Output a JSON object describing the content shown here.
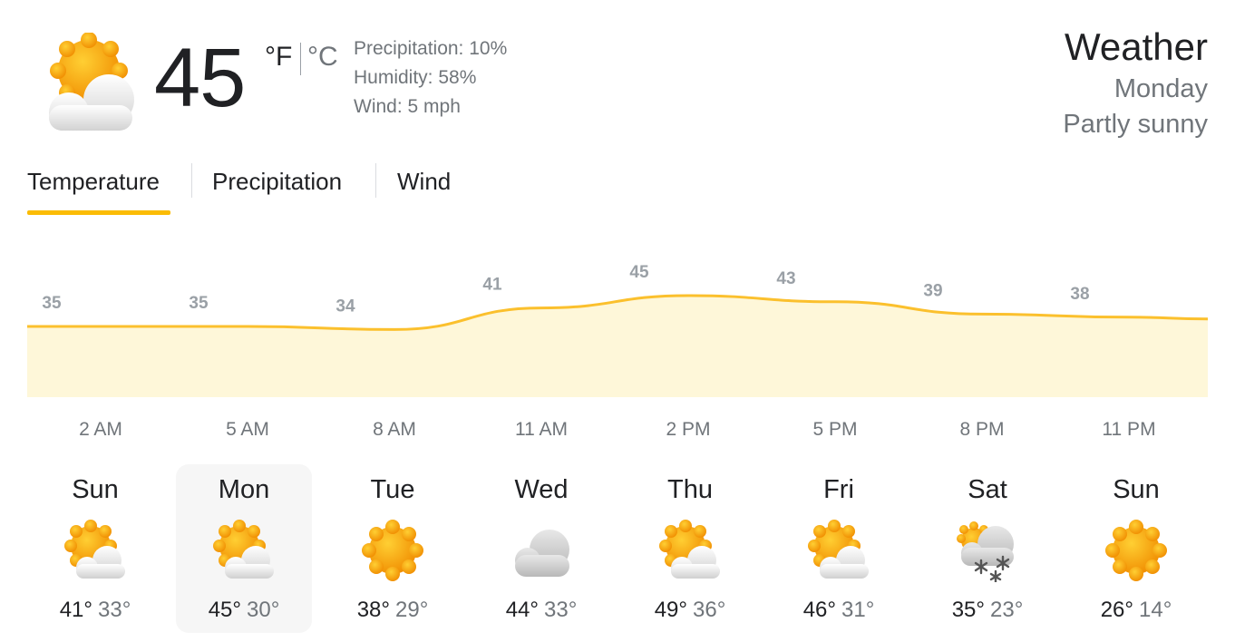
{
  "current": {
    "temp": "45",
    "unit_f": "°F",
    "unit_c": "°C",
    "precipitation": "Precipitation: 10%",
    "humidity": "Humidity: 58%",
    "wind": "Wind: 5 mph",
    "icon": "partly-cloudy-icon"
  },
  "header": {
    "title": "Weather",
    "day": "Monday",
    "description": "Partly sunny"
  },
  "tabs": [
    {
      "label": "Temperature",
      "selected": true
    },
    {
      "label": "Precipitation",
      "selected": false
    },
    {
      "label": "Wind",
      "selected": false
    }
  ],
  "chart_data": {
    "type": "area",
    "x": [
      "2 AM",
      "5 AM",
      "8 AM",
      "11 AM",
      "2 PM",
      "5 PM",
      "8 PM",
      "11 PM"
    ],
    "values": [
      35,
      35,
      34,
      41,
      45,
      43,
      39,
      38
    ],
    "color": "#fbc02d",
    "fill": "#fef7d9"
  },
  "hours": [
    "2 AM",
    "5 AM",
    "8 AM",
    "11 AM",
    "2 PM",
    "5 PM",
    "8 PM",
    "11 PM"
  ],
  "days": [
    {
      "name": "Sun",
      "high": "41°",
      "low": "33°",
      "icon": "partly-cloudy-icon",
      "selected": false
    },
    {
      "name": "Mon",
      "high": "45°",
      "low": "30°",
      "icon": "partly-cloudy-icon",
      "selected": true
    },
    {
      "name": "Tue",
      "high": "38°",
      "low": "29°",
      "icon": "sunny-icon",
      "selected": false
    },
    {
      "name": "Wed",
      "high": "44°",
      "low": "33°",
      "icon": "cloudy-icon",
      "selected": false
    },
    {
      "name": "Thu",
      "high": "49°",
      "low": "36°",
      "icon": "partly-cloudy-icon",
      "selected": false
    },
    {
      "name": "Fri",
      "high": "46°",
      "low": "31°",
      "icon": "partly-cloudy-icon",
      "selected": false
    },
    {
      "name": "Sat",
      "high": "35°",
      "low": "23°",
      "icon": "snow-icon",
      "selected": false
    },
    {
      "name": "Sun",
      "high": "26°",
      "low": "14°",
      "icon": "sunny-icon",
      "selected": false
    }
  ]
}
